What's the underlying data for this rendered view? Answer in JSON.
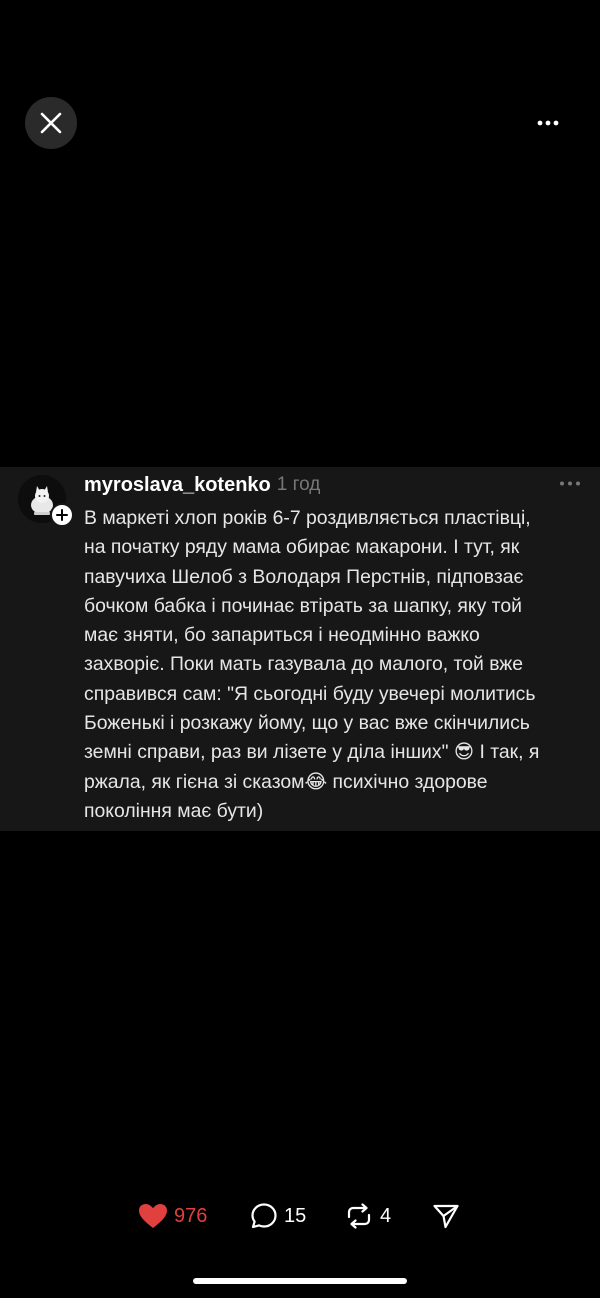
{
  "top_bar": {
    "close_icon": "close-icon",
    "more_icon": "more-horizontal-icon"
  },
  "post": {
    "username": "myroslava_kotenko",
    "time": "1 год",
    "avatar_icon": "cat-avatar",
    "follow_icon": "plus-icon",
    "more_icon": "more-horizontal-icon",
    "lines": [
      "В маркеті хлоп років 6-7 роздивляється пластівці,",
      "на початку ряду мама обирає макарони. І тут, як",
      "павучиха Шелоб з Володаря Перстнів, підповзає",
      "бочком бабка і починає втірать за шапку, яку той",
      "має зняти, бо запариться і неодмінно важко",
      "захворіє. Поки мать газувала до малого, той вже",
      "справився сам: \"Я сьогодні буду увечері молитись",
      "Боженькі і розкажу йому, що у вас вже скінчились",
      "земні справи, раз ви лізете у діла інших\" 😎 І так, я",
      "ржала, як гієна зі сказом😂 психічно здорове",
      "покоління має бути)"
    ]
  },
  "actions": {
    "likes": "976",
    "comments": "15",
    "reposts": "4",
    "icons": [
      "heart-icon",
      "comment-icon",
      "repost-icon",
      "share-icon"
    ],
    "colors": {
      "like": "#e0403e",
      "text": "#ffffff"
    }
  }
}
